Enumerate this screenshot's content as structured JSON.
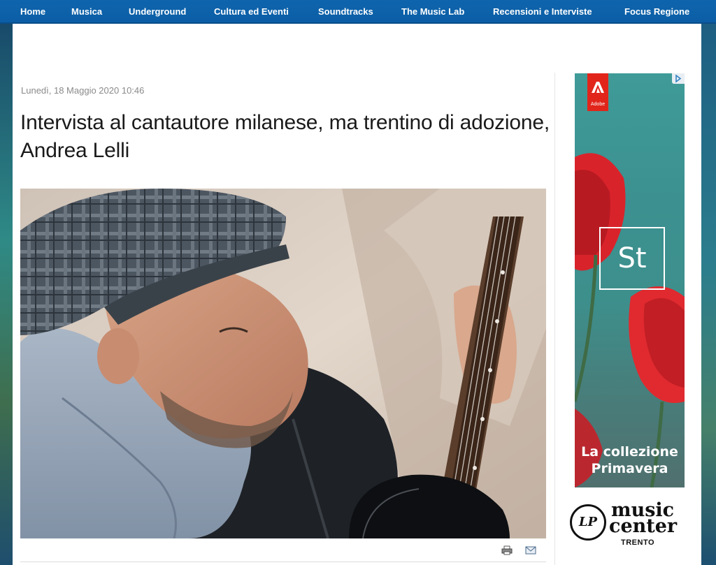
{
  "nav": {
    "items": [
      {
        "label": "Home"
      },
      {
        "label": "Musica"
      },
      {
        "label": "Underground"
      },
      {
        "label": "Cultura ed Eventi"
      },
      {
        "label": "Soundtracks"
      },
      {
        "label": "The Music Lab"
      },
      {
        "label": "Recensioni e Interviste"
      },
      {
        "label": "Focus Regione"
      }
    ]
  },
  "article": {
    "date": "Lunedì, 18 Maggio 2020 10:46",
    "title": "Intervista al cantautore milanese, ma trentino di adozione, Andrea Lelli",
    "tools": [
      "print-icon",
      "email-icon"
    ]
  },
  "ad": {
    "brand": "Adobe",
    "product_mark": "St",
    "caption": "La collezione Primavera",
    "adchoices_icon": "adchoices-icon"
  },
  "sponsor": {
    "line1": "music",
    "line2": "center",
    "city": "TRENTO",
    "badge": "LP"
  },
  "colors": {
    "nav_bg": "#0b5ea6",
    "ad_accent": "#e1251b"
  }
}
